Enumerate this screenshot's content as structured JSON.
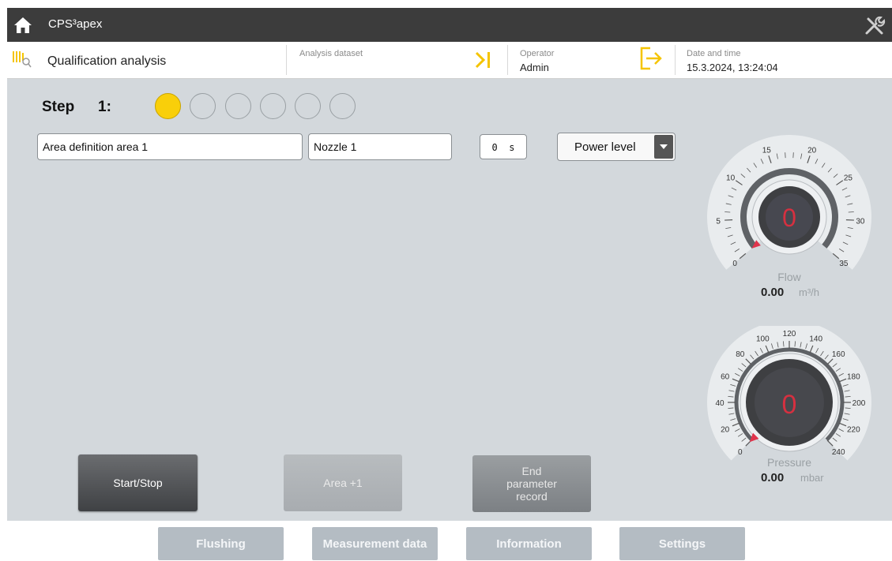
{
  "header": {
    "app_title": "CPS³apex",
    "home_icon": "home-icon",
    "tools_icon": "tools-icon"
  },
  "infobar": {
    "module_title": "Qualification analysis",
    "analysis_dataset_label": "Analysis dataset",
    "operator_label": "Operator",
    "operator_value": "Admin",
    "datetime_label": "Date and time",
    "datetime_value": "15.3.2024, 13:24:04",
    "accent_color": "#f5c400"
  },
  "step": {
    "label": "Step",
    "number": "1:",
    "total": 6,
    "current": 1
  },
  "fields": {
    "area_name": "Area definition area 1",
    "nozzle": "Nozzle 1",
    "time_value": "0",
    "time_unit": "s",
    "power_level_label": "Power level"
  },
  "actions": {
    "start_stop": "Start/Stop",
    "area_plus": "Area +1",
    "end_record": "End parameter record"
  },
  "flow_gauge": {
    "value_display": "0",
    "caption": "Flow",
    "reading": "0.00",
    "unit": "m³/h",
    "ticks": [
      "0",
      "5",
      "10",
      "15",
      "20",
      "25",
      "30",
      "35"
    ],
    "min": 0,
    "max": 35,
    "value": 0
  },
  "pressure_gauge": {
    "value_display": "0",
    "caption": "Pressure",
    "reading": "0.00",
    "unit": "mbar",
    "ticks": [
      "0",
      "20",
      "40",
      "60",
      "80",
      "100",
      "120",
      "140",
      "160",
      "180",
      "200",
      "220",
      "240"
    ],
    "min": 0,
    "max": 240,
    "value": 0
  },
  "nav": {
    "flushing": "Flushing",
    "measurement_data": "Measurement data",
    "information": "Information",
    "settings": "Settings"
  },
  "colors": {
    "title_bar": "#3c3c3c",
    "background": "#d3d8dc",
    "active_step": "#f9cf0a",
    "gauge_needle": "#e0344c",
    "nav_button": "#b4bcc3"
  }
}
